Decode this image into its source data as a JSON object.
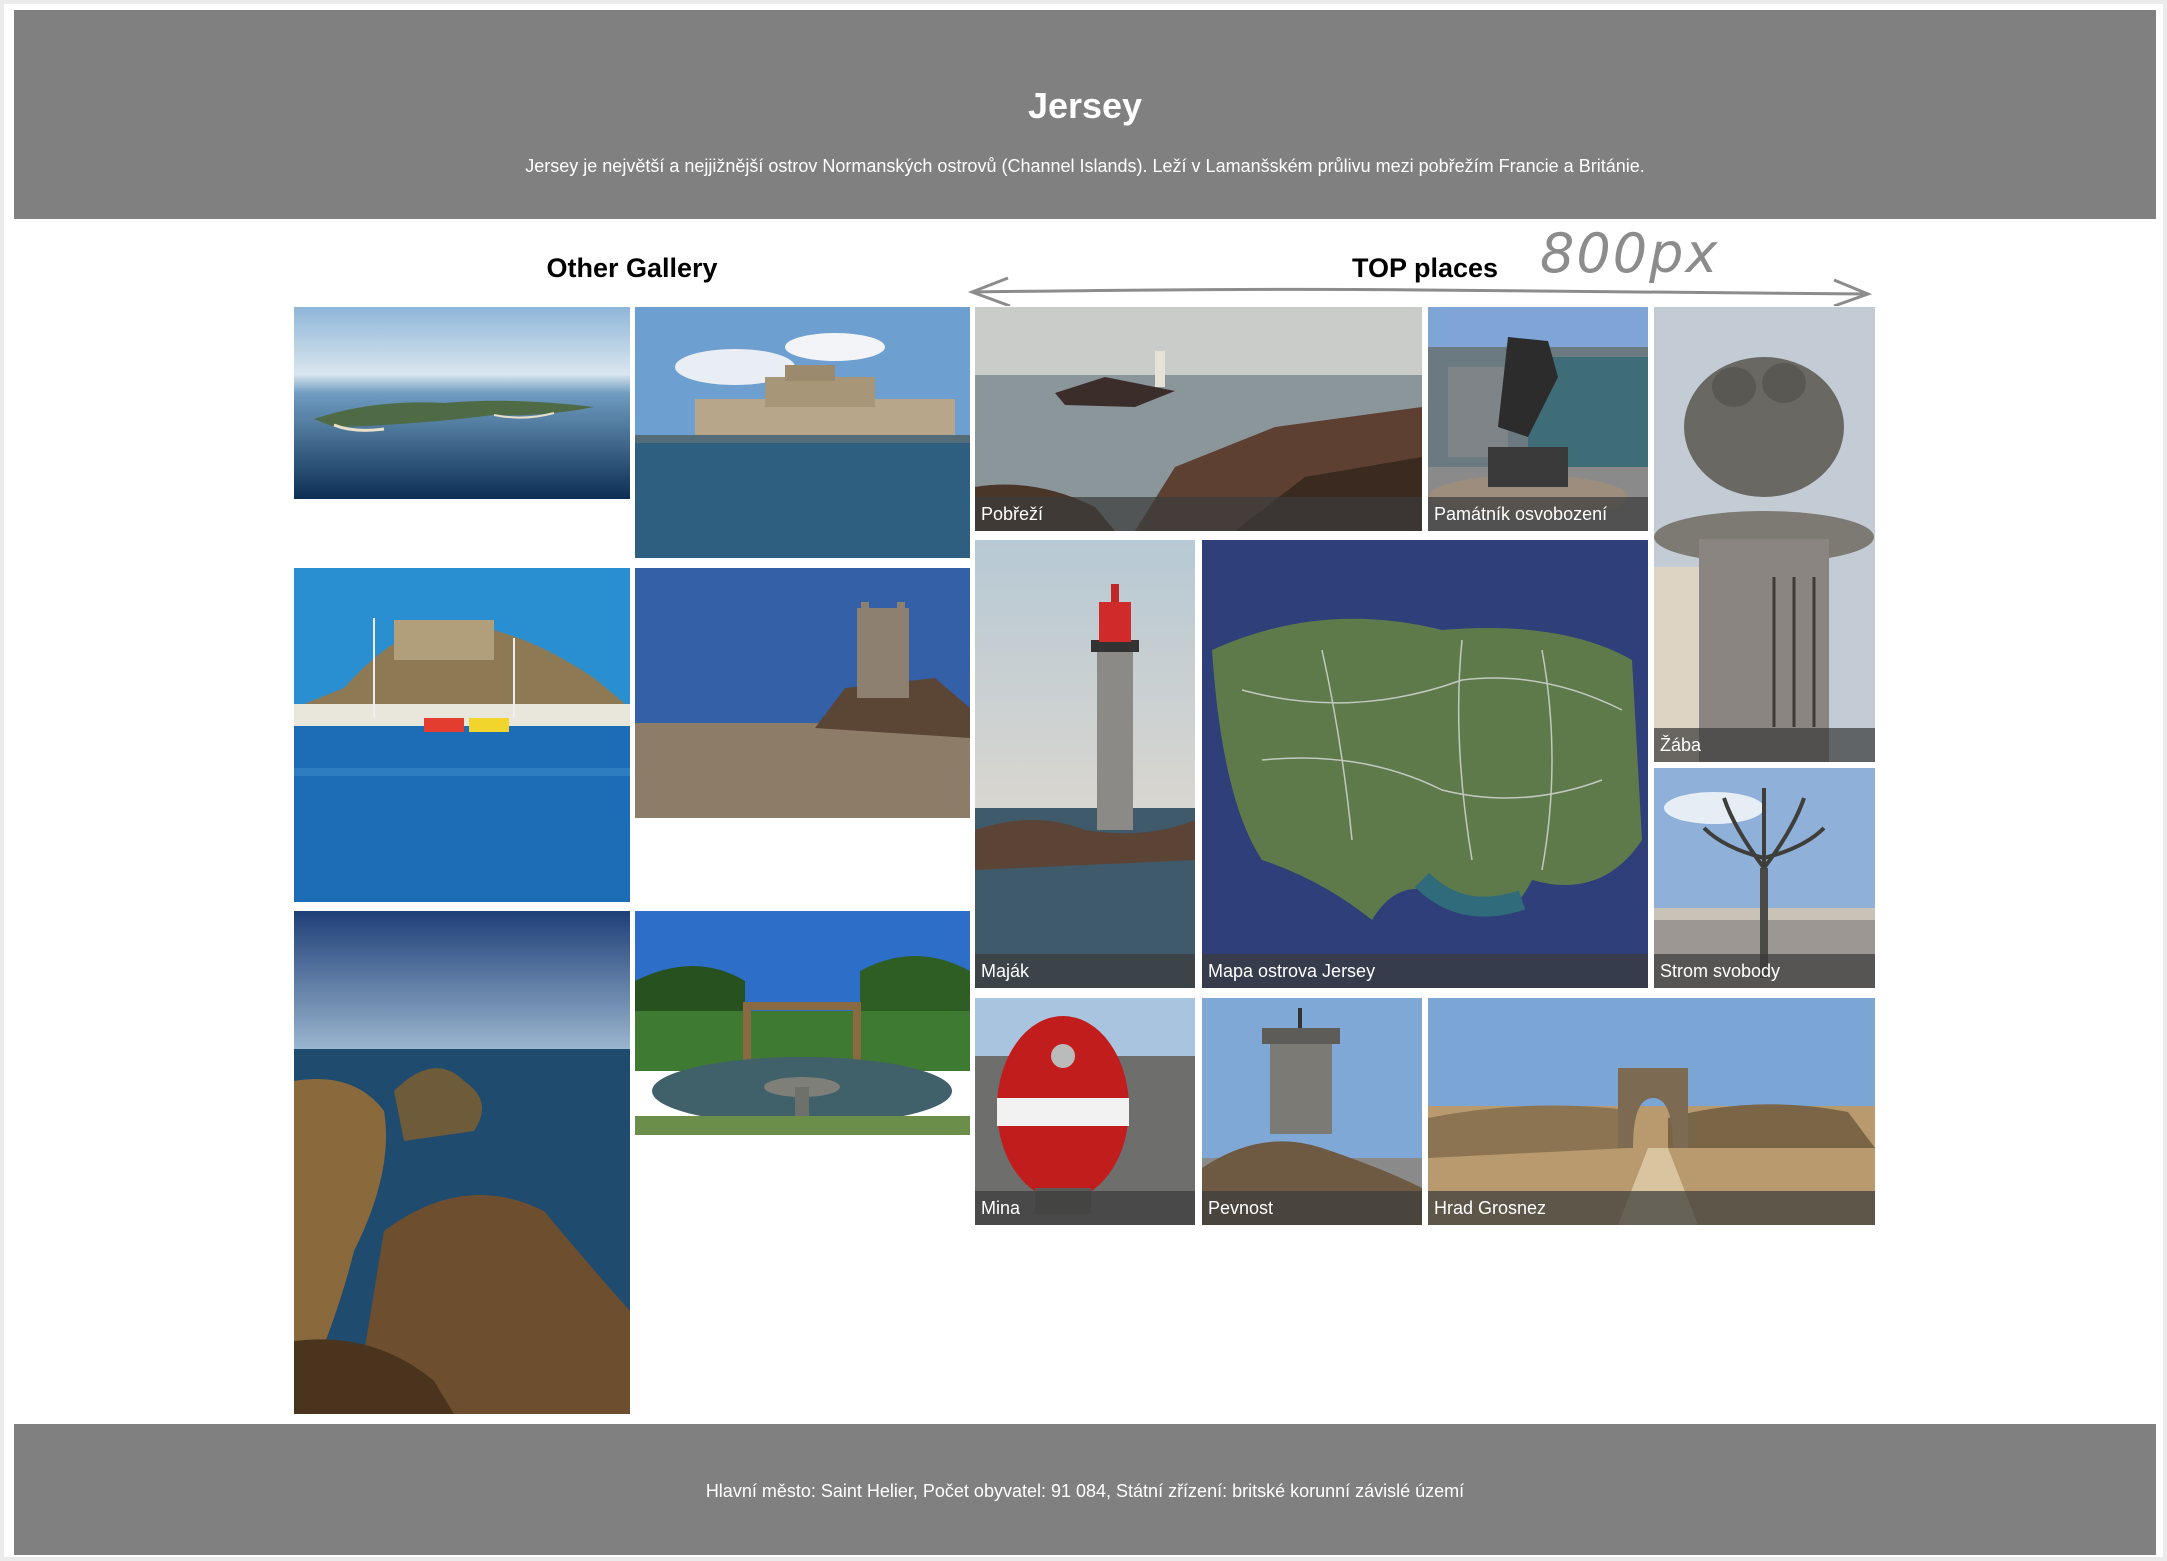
{
  "header": {
    "title": "Jersey",
    "description": "Jersey je největší a nejjižnější ostrov Normanských ostrovů (Channel Islands). Leží v Lamanšském průlivu mezi pobřežím Francie a Británie."
  },
  "other_gallery": {
    "heading": "Other Gallery"
  },
  "top_places": {
    "heading": "TOP places",
    "annotation": "800px",
    "items": [
      {
        "caption": "Pobřeží"
      },
      {
        "caption": "Památník osvobození"
      },
      {
        "caption": "Žába"
      },
      {
        "caption": "Maják"
      },
      {
        "caption": "Mapa ostrova Jersey"
      },
      {
        "caption": "Strom svobody"
      },
      {
        "caption": "Mina"
      },
      {
        "caption": "Pevnost"
      },
      {
        "caption": "Hrad Grosnez"
      }
    ]
  },
  "footer": {
    "text": "Hlavní město: Saint Helier, Počet obyvatel: 91 084, Státní zřízení: britské korunní závislé území"
  },
  "colors": {
    "header_bg": "#808080",
    "footer_bg": "#808080",
    "caption_bg": "#3c3c3c",
    "annotation": "#8c8c8c"
  }
}
